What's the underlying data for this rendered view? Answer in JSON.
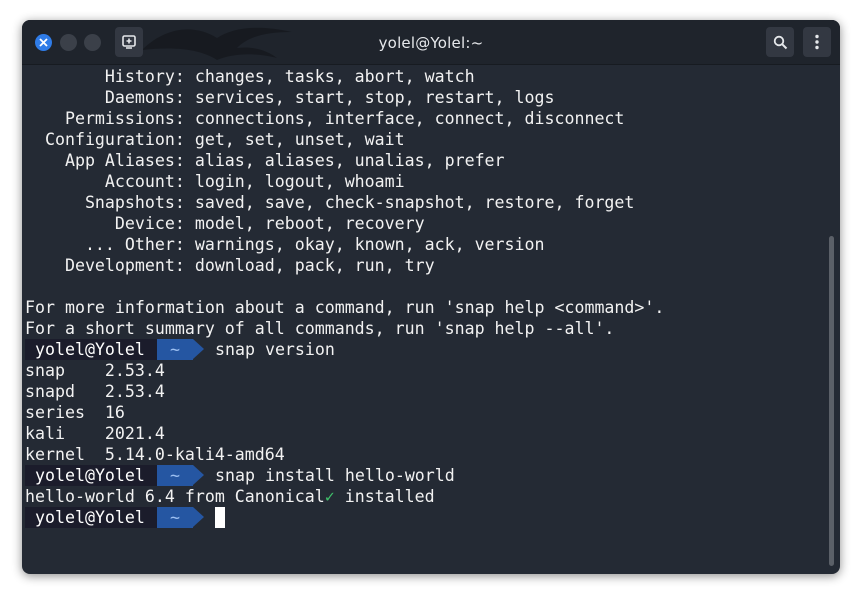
{
  "window": {
    "title": "yolel@Yolel:~",
    "controls": [
      "close-icon",
      "minimize-icon",
      "maximize-icon"
    ],
    "toolbar_icons": [
      "new-tab-icon",
      "search-icon",
      "menu-dots-icon"
    ]
  },
  "terminal": {
    "help_lines": [
      "        History: changes, tasks, abort, watch",
      "        Daemons: services, start, stop, restart, logs",
      "    Permissions: connections, interface, connect, disconnect",
      "  Configuration: get, set, unset, wait",
      "    App Aliases: alias, aliases, unalias, prefer",
      "        Account: login, logout, whoami",
      "      Snapshots: saved, save, check-snapshot, restore, forget",
      "         Device: model, reboot, recovery",
      "      ... Other: warnings, okay, known, ack, version",
      "    Development: download, pack, run, try"
    ],
    "info_lines": [
      "For more information about a command, run 'snap help <command>'.",
      "For a short summary of all commands, run 'snap help --all'."
    ],
    "prompt_user": "yolel@Yolel",
    "prompt_dir": "~",
    "cmd1": "snap version",
    "version_lines": [
      "snap    2.53.4",
      "snapd   2.53.4",
      "series  16",
      "kali    2021.4",
      "kernel  5.14.0-kali4-amd64"
    ],
    "cmd2": "snap install hello-world",
    "install_prefix": "hello-world 6.4 from Canonical",
    "install_check": "✓",
    "install_suffix": " installed"
  },
  "colors": {
    "background": "#242a34",
    "prompt_user_bg": "#1b1c2b",
    "prompt_dir_bg": "#2556a2",
    "accent_close": "#2f7ce8",
    "check": "#3fbf6a"
  }
}
